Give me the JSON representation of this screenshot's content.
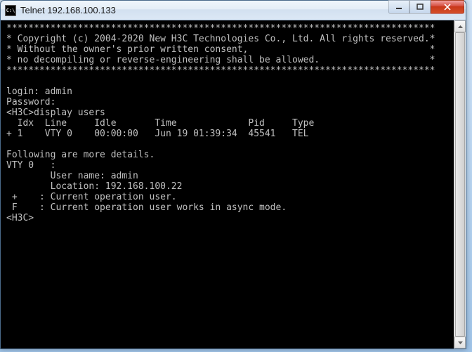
{
  "window": {
    "icon_label": "C:\\",
    "title": "Telnet 192.168.100.133"
  },
  "terminal": {
    "banner_border": "******************************************************************************",
    "copy1": "* Copyright (c) 2004-2020 New H3C Technologies Co., Ltd. All rights reserved.*",
    "copy2": "* Without the owner's prior written consent,                                 *",
    "copy3": "* no decompiling or reverse-engineering shall be allowed.                    *",
    "login_prompt": "login: admin",
    "password_prompt": "Password:",
    "cmd_line": "<H3C>display users",
    "header": "  Idx  Line     Idle       Time             Pid     Type",
    "row": "+ 1    VTY 0    00:00:00   Jun 19 01:39:34  45541   TEL",
    "details_header": "Following are more details.",
    "vty_line": "VTY 0   :",
    "user_line": "        User name: admin",
    "loc_line": "        Location: 192.168.100.22",
    "plus_note": " +    : Current operation user.",
    "f_note": " F    : Current operation user works in async mode.",
    "prompt": "<H3C>"
  },
  "users_table": {
    "columns": [
      "Idx",
      "Line",
      "Idle",
      "Time",
      "Pid",
      "Type"
    ],
    "rows": [
      {
        "marker": "+",
        "idx": 1,
        "line": "VTY 0",
        "idle": "00:00:00",
        "time": "Jun 19 01:39:34",
        "pid": 45541,
        "type": "TEL"
      }
    ],
    "details": [
      {
        "line": "VTY 0",
        "user_name": "admin",
        "location": "192.168.100.22"
      }
    ],
    "legend": {
      "+": "Current operation user.",
      "F": "Current operation user works in async mode."
    }
  }
}
